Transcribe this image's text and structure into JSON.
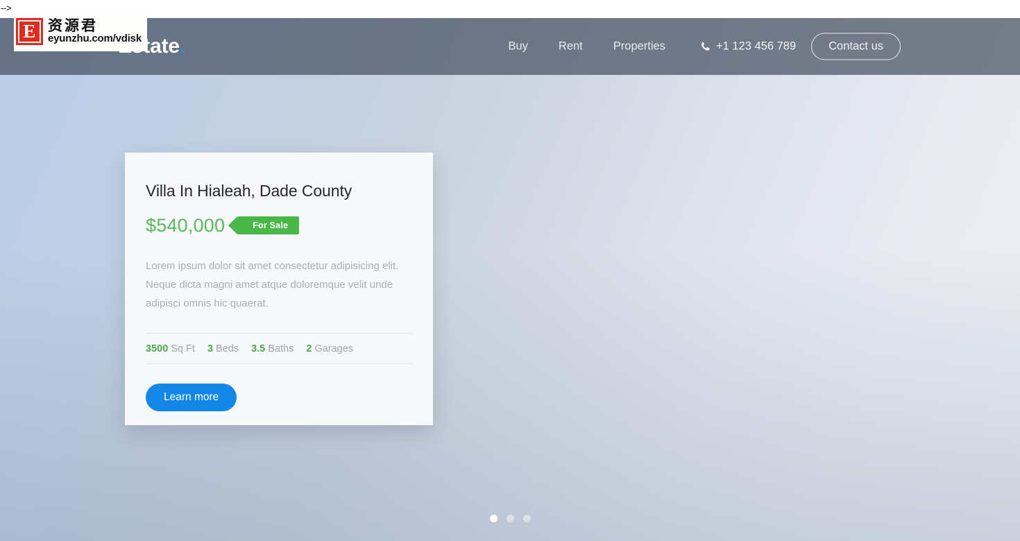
{
  "artifact": {
    "stray_text": "-->"
  },
  "header": {
    "brand": "Estate",
    "brand_dot": ".",
    "nav": [
      {
        "label": "Buy",
        "name": "nav-link-buy"
      },
      {
        "label": "Rent",
        "name": "nav-link-rent"
      },
      {
        "label": "Properties",
        "name": "nav-link-properties"
      }
    ],
    "phone": {
      "icon": "phone-icon",
      "number": "+1 123 456 789"
    },
    "contact_label": "Contact us",
    "background_color": "#3e4858"
  },
  "hero": {
    "gradient_from": "#b9cde8",
    "gradient_to": "#eceef4"
  },
  "card": {
    "title": "Villa In Hialeah, Dade County",
    "price": "$540,000",
    "price_color": "#5cb85c",
    "status": "For Sale",
    "status_color": "#49b849",
    "description": "Lorem ipsum dolor sit amet consectetur adipisicing elit. Neque dicta magni amet atque doloremque velit unde adipisci omnis hic quaerat.",
    "stats": [
      {
        "value": "3500",
        "label": "Sq Ft"
      },
      {
        "value": "3",
        "label": "Beds"
      },
      {
        "value": "3.5",
        "label": "Baths"
      },
      {
        "value": "2",
        "label": "Garages"
      }
    ],
    "cta_label": "Learn more",
    "cta_color": "#1287e8"
  },
  "carousel": {
    "dots": [
      {
        "active": true
      },
      {
        "active": false
      },
      {
        "active": false
      }
    ],
    "active_index": 0
  },
  "watermark": {
    "badge_letter": "E",
    "chinese": "资源君",
    "url": "eyunzhu.com/vdisk",
    "badge_color": "#e02b20"
  }
}
